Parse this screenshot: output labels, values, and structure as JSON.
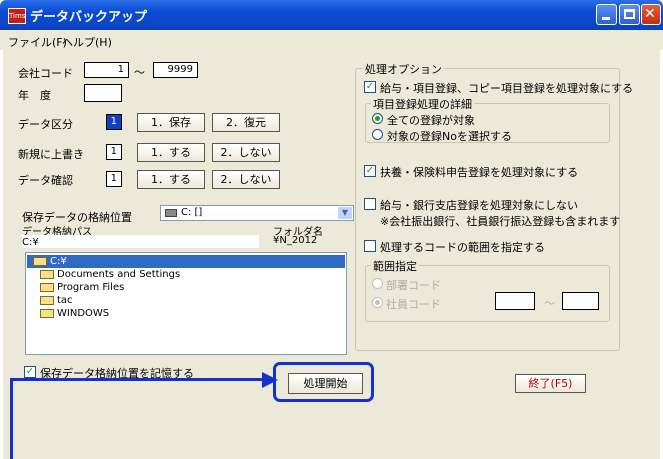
{
  "window": {
    "title": "データバックアップ",
    "app_icon_text": "Tims"
  },
  "menu": {
    "items": [
      "ファイル(F)",
      "ヘルプ(H)"
    ]
  },
  "company": {
    "label": "会社コード",
    "from": "1",
    "tilde": "～",
    "to": "9999"
  },
  "year": {
    "label": "年　度",
    "value": ""
  },
  "data_kind": {
    "label": "データ区分",
    "value": "1",
    "options": [
      "1．保存",
      "2．復元"
    ]
  },
  "overwrite": {
    "label": "新規に上書き",
    "value": "1",
    "options": [
      "1．する",
      "2．しない"
    ]
  },
  "confirm": {
    "label": "データ確認",
    "value": "1",
    "options": [
      "1．する",
      "2．しない"
    ]
  },
  "storage": {
    "label": "保存データの格納位置",
    "drive": "C: []",
    "path_label": "データ格納パス",
    "path_value": "C:¥",
    "folder_label": "フォルダ名",
    "folder_value": "¥N_2012",
    "tree": [
      "C:¥",
      "Documents and Settings",
      "Program Files",
      "tac",
      "WINDOWS"
    ]
  },
  "remember": {
    "label": "保存データ格納位置を記憶する",
    "checked": true
  },
  "start_button": "処理開始",
  "exit_button": "終了(F5)",
  "options": {
    "title": "処理オプション",
    "salary_label": "給与・項目登録、コピー項目登録を処理対象にする",
    "detail_title": "項目登録処理の詳細",
    "radio_all": "全ての登録が対象",
    "radio_select": "対象の登録Noを選択する",
    "insurance_label": "扶養・保険料申告登録を処理対象にする",
    "bank_label": "給与・銀行支店登録を処理対象にしない",
    "bank_note": "※会社振出銀行、社員銀行振込登録も含まれます",
    "range_label": "処理するコードの範囲を指定する",
    "range_title": "範囲指定",
    "dept_code": "部署コード",
    "emp_code": "社員コード",
    "range_tilde": "～"
  }
}
